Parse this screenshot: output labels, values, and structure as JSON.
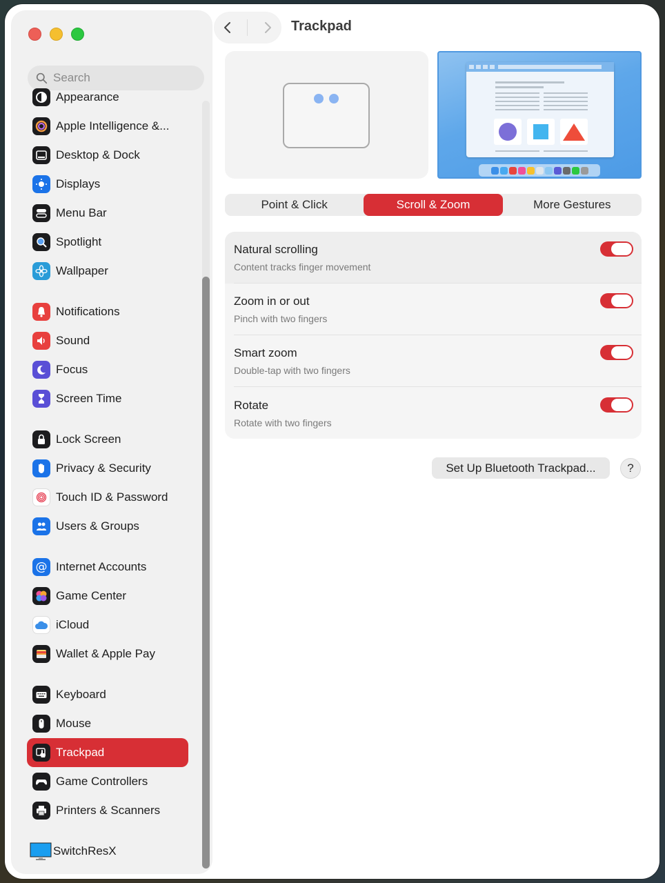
{
  "window": {
    "title": "Trackpad"
  },
  "search": {
    "placeholder": "Search"
  },
  "sidebar": {
    "items": [
      {
        "label": "Appearance",
        "icon": "appearance-icon"
      },
      {
        "label": "Apple Intelligence &...",
        "icon": "apple-intelligence-icon"
      },
      {
        "label": "Desktop & Dock",
        "icon": "desktop-dock-icon"
      },
      {
        "label": "Displays",
        "icon": "displays-icon"
      },
      {
        "label": "Menu Bar",
        "icon": "menu-bar-icon"
      },
      {
        "label": "Spotlight",
        "icon": "spotlight-icon"
      },
      {
        "label": "Wallpaper",
        "icon": "wallpaper-icon"
      },
      {
        "label": "Notifications",
        "icon": "notifications-icon"
      },
      {
        "label": "Sound",
        "icon": "sound-icon"
      },
      {
        "label": "Focus",
        "icon": "focus-icon"
      },
      {
        "label": "Screen Time",
        "icon": "screen-time-icon"
      },
      {
        "label": "Lock Screen",
        "icon": "lock-screen-icon"
      },
      {
        "label": "Privacy & Security",
        "icon": "privacy-hand-icon"
      },
      {
        "label": "Touch ID & Password",
        "icon": "fingerprint-icon"
      },
      {
        "label": "Users & Groups",
        "icon": "users-icon"
      },
      {
        "label": "Internet Accounts",
        "icon": "at-sign-icon"
      },
      {
        "label": "Game Center",
        "icon": "game-center-icon"
      },
      {
        "label": "iCloud",
        "icon": "icloud-icon"
      },
      {
        "label": "Wallet & Apple Pay",
        "icon": "wallet-icon"
      },
      {
        "label": "Keyboard",
        "icon": "keyboard-icon"
      },
      {
        "label": "Mouse",
        "icon": "mouse-icon"
      },
      {
        "label": "Trackpad",
        "icon": "trackpad-icon",
        "selected": true
      },
      {
        "label": "Game Controllers",
        "icon": "gamepad-icon"
      },
      {
        "label": "Printers & Scanners",
        "icon": "printer-icon"
      },
      {
        "label": "SwitchResX",
        "icon": "monitor-icon"
      }
    ]
  },
  "tabs": [
    {
      "label": "Point & Click"
    },
    {
      "label": "Scroll & Zoom",
      "selected": true
    },
    {
      "label": "More Gestures"
    }
  ],
  "settings": [
    {
      "title": "Natural scrolling",
      "subtitle": "Content tracks finger movement",
      "on": true
    },
    {
      "title": "Zoom in or out",
      "subtitle": "Pinch with two fingers",
      "on": true
    },
    {
      "title": "Smart zoom",
      "subtitle": "Double-tap with two fingers",
      "on": true
    },
    {
      "title": "Rotate",
      "subtitle": "Rotate with two fingers",
      "on": true
    }
  ],
  "buttons": {
    "bluetooth": "Set Up Bluetooth Trackpad...",
    "help": "?"
  },
  "colors": {
    "accent": "#d72f35",
    "sidebar_bg": "#f1f1f1"
  }
}
